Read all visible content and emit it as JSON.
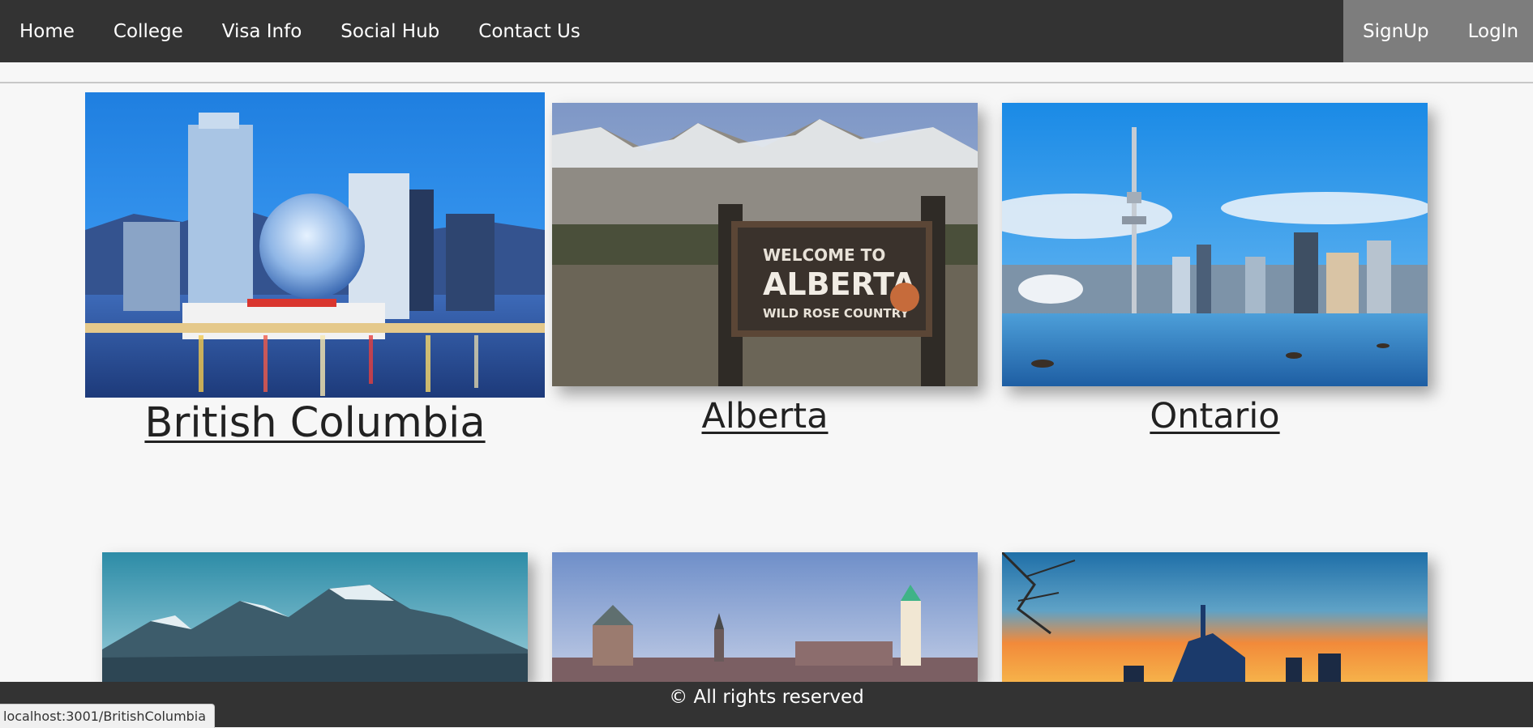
{
  "nav": {
    "links": [
      "Home",
      "College",
      "Visa Info",
      "Social Hub",
      "Contact Us"
    ],
    "auth": [
      "SignUp",
      "LogIn"
    ]
  },
  "provinces": [
    {
      "name": "British Columbia",
      "image": "vancouver-science-world-skyline"
    },
    {
      "name": "Alberta",
      "image": "welcome-to-alberta-sign-mountains",
      "sign_lines": [
        "WELCOME TO",
        "ALBERTA",
        "WILD ROSE COUNTRY"
      ]
    },
    {
      "name": "Ontario",
      "image": "toronto-cn-tower-skyline"
    }
  ],
  "more_images": [
    "rocky-mountains",
    "quebec-city-skyline",
    "winnipeg-sunset-skyline"
  ],
  "footer": {
    "text": "© All rights reserved"
  },
  "status_bar": {
    "url": "localhost:3001/BritishColumbia"
  },
  "colors": {
    "nav_bg": "#333333",
    "nav_auth_bg": "#7d7d7d",
    "page_bg": "#f7f7f7",
    "footer_bg": "#333333"
  }
}
